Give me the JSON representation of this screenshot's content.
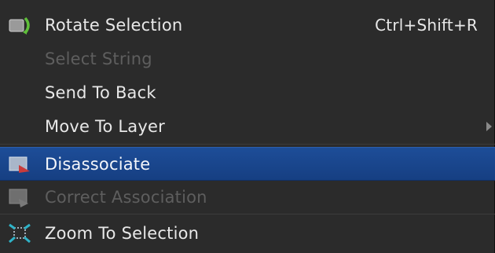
{
  "menu": {
    "items": [
      {
        "label": "Rotate Selection",
        "shortcut": "Ctrl+Shift+R",
        "icon": "rotate-icon",
        "state": "normal"
      },
      {
        "label": "Select String",
        "icon": "",
        "state": "disabled"
      },
      {
        "label": "Send To Back",
        "icon": "",
        "state": "normal"
      },
      {
        "label": "Move To Layer",
        "icon": "",
        "state": "normal",
        "submenu": true
      },
      {
        "label": "Disassociate",
        "icon": "disassociate-icon",
        "state": "highlighted"
      },
      {
        "label": "Correct Association",
        "icon": "correct-association-icon",
        "state": "disabled"
      },
      {
        "label": "Zoom To Selection",
        "icon": "zoom-to-selection-icon",
        "state": "normal"
      }
    ]
  },
  "colors": {
    "menu_bg": "#2b2b2b",
    "highlight": "#1d4d98",
    "text": "#e8e8e8",
    "disabled_text": "#5e5e5e"
  }
}
